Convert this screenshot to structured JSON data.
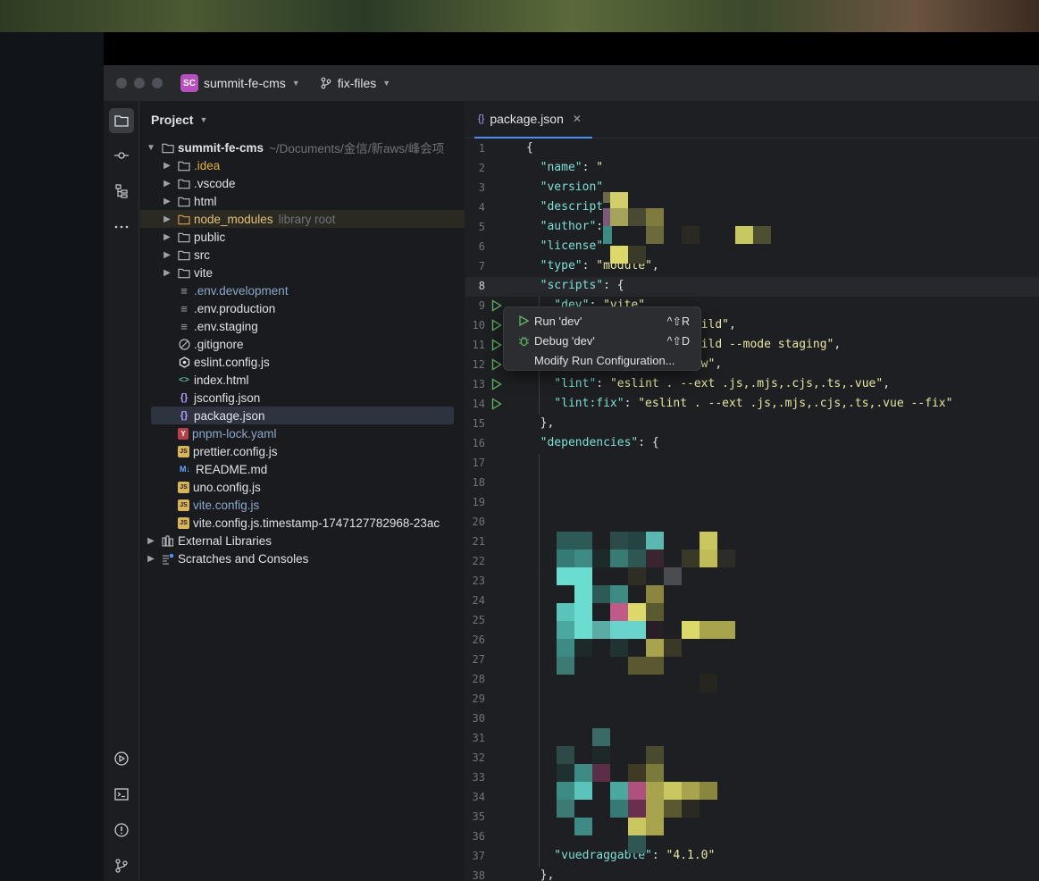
{
  "window": {
    "project_badge": "SC",
    "project_name": "summit-fe-cms",
    "branch": "fix-files"
  },
  "project_panel": {
    "title": "Project",
    "root_name": "summit-fe-cms",
    "root_path": "~/Documents/金信/新aws/峰会项",
    "items": [
      {
        "label": ".idea",
        "hint": ""
      },
      {
        "label": ".vscode",
        "hint": ""
      },
      {
        "label": "html",
        "hint": ""
      },
      {
        "label": "node_modules",
        "hint": "library root"
      },
      {
        "label": "public",
        "hint": ""
      },
      {
        "label": "src",
        "hint": ""
      },
      {
        "label": "vite",
        "hint": ""
      },
      {
        "label": ".env.development",
        "hint": ""
      },
      {
        "label": ".env.production",
        "hint": ""
      },
      {
        "label": ".env.staging",
        "hint": ""
      },
      {
        "label": ".gitignore",
        "hint": ""
      },
      {
        "label": "eslint.config.js",
        "hint": ""
      },
      {
        "label": "index.html",
        "hint": ""
      },
      {
        "label": "jsconfig.json",
        "hint": ""
      },
      {
        "label": "package.json",
        "hint": ""
      },
      {
        "label": "pnpm-lock.yaml",
        "hint": ""
      },
      {
        "label": "prettier.config.js",
        "hint": ""
      },
      {
        "label": "README.md",
        "hint": ""
      },
      {
        "label": "uno.config.js",
        "hint": ""
      },
      {
        "label": "vite.config.js",
        "hint": ""
      },
      {
        "label": "vite.config.js.timestamp-1747127782968-23ac",
        "hint": ""
      },
      {
        "label": "External Libraries",
        "hint": ""
      },
      {
        "label": "Scratches and Consoles",
        "hint": ""
      }
    ]
  },
  "editor": {
    "tab_label": "package.json",
    "lines": [
      {
        "n": "1",
        "parts": [
          [
            "p",
            "{"
          ]
        ]
      },
      {
        "n": "2",
        "parts": [
          [
            "key",
            "  \"name\""
          ],
          [
            "p",
            ": "
          ],
          [
            "str",
            "\""
          ]
        ]
      },
      {
        "n": "3",
        "parts": [
          [
            "key",
            "  \"version\""
          ]
        ]
      },
      {
        "n": "4",
        "parts": [
          [
            "key",
            "  \"descript"
          ]
        ]
      },
      {
        "n": "5",
        "parts": [
          [
            "key",
            "  \"author\""
          ],
          [
            "p",
            ": "
          ]
        ]
      },
      {
        "n": "6",
        "parts": [
          [
            "key",
            "  \"license\""
          ]
        ]
      },
      {
        "n": "7",
        "parts": [
          [
            "key",
            "  \"type\""
          ],
          [
            "p",
            ": "
          ],
          [
            "str",
            "\"module\""
          ],
          [
            "p",
            ","
          ]
        ]
      },
      {
        "n": "8",
        "parts": [
          [
            "key",
            "  \"scripts\""
          ],
          [
            "p",
            ": {"
          ]
        ]
      },
      {
        "n": "9",
        "parts": [
          [
            "key",
            "    \"dev\""
          ],
          [
            "p",
            ": "
          ],
          [
            "str",
            "\"vite\""
          ]
        ]
      },
      {
        "n": "10",
        "parts": [
          [
            "str",
            "                         ild\""
          ],
          [
            "p",
            ","
          ]
        ]
      },
      {
        "n": "11",
        "parts": [
          [
            "str",
            "                         ild --mode staging\""
          ],
          [
            "p",
            ","
          ]
        ]
      },
      {
        "n": "12",
        "parts": [
          [
            "str",
            "                         w\""
          ],
          [
            "p",
            ","
          ]
        ]
      },
      {
        "n": "13",
        "parts": [
          [
            "key",
            "    \"lint\""
          ],
          [
            "p",
            ": "
          ],
          [
            "str",
            "\"eslint . --ext .js,.mjs,.cjs,.ts,.vue\""
          ],
          [
            "p",
            ","
          ]
        ]
      },
      {
        "n": "14",
        "parts": [
          [
            "key",
            "    \"lint:fix\""
          ],
          [
            "p",
            ": "
          ],
          [
            "str",
            "\"eslint . --ext .js,.mjs,.cjs,.ts,.vue --fix\""
          ]
        ]
      },
      {
        "n": "15",
        "parts": [
          [
            "p",
            "  },"
          ]
        ]
      },
      {
        "n": "16",
        "parts": [
          [
            "key",
            "  \"dependencies\""
          ],
          [
            "p",
            ": {"
          ]
        ]
      },
      {
        "n": "17",
        "parts": []
      },
      {
        "n": "18",
        "parts": []
      },
      {
        "n": "19",
        "parts": []
      },
      {
        "n": "20",
        "parts": []
      },
      {
        "n": "21",
        "parts": []
      },
      {
        "n": "22",
        "parts": []
      },
      {
        "n": "23",
        "parts": []
      },
      {
        "n": "24",
        "parts": []
      },
      {
        "n": "25",
        "parts": []
      },
      {
        "n": "26",
        "parts": []
      },
      {
        "n": "27",
        "parts": []
      },
      {
        "n": "28",
        "parts": []
      },
      {
        "n": "29",
        "parts": []
      },
      {
        "n": "30",
        "parts": []
      },
      {
        "n": "31",
        "parts": []
      },
      {
        "n": "32",
        "parts": []
      },
      {
        "n": "33",
        "parts": []
      },
      {
        "n": "34",
        "parts": []
      },
      {
        "n": "35",
        "parts": []
      },
      {
        "n": "36",
        "parts": []
      },
      {
        "n": "37",
        "parts": [
          [
            "key",
            "    \"vuedraggable\""
          ],
          [
            "p",
            ": "
          ],
          [
            "str",
            "\"4.1.0\""
          ]
        ]
      },
      {
        "n": "38",
        "parts": [
          [
            "p",
            "  },"
          ]
        ]
      }
    ]
  },
  "run_popup": {
    "run_label": "Run 'dev'",
    "run_shortcut": "^⇧R",
    "debug_label": "Debug 'dev'",
    "debug_shortcut": "^⇧D",
    "modify_label": "Modify Run Configuration..."
  },
  "colors": {
    "accent": "#4c8df6",
    "run_green": "#5fb865",
    "project_badge": "#b84fbf"
  }
}
